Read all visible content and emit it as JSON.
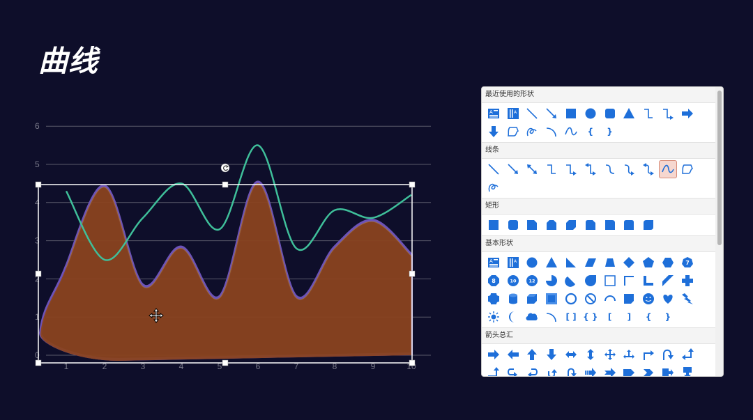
{
  "slide": {
    "title": "曲线"
  },
  "chart_data": {
    "type": "area",
    "x": [
      1,
      2,
      3,
      4,
      5,
      6,
      7,
      8,
      9,
      10
    ],
    "yticks": [
      "0",
      "1",
      "2",
      "3",
      "4",
      "5",
      "6"
    ],
    "xticks": [
      "1",
      "2",
      "3",
      "4",
      "5",
      "6",
      "7",
      "8",
      "9",
      "10"
    ],
    "ylim": [
      0,
      6
    ],
    "grid": true,
    "series": [
      {
        "type": "line",
        "values": [
          4.3,
          2.5,
          3.6,
          4.5,
          3.3,
          5.5,
          2.8,
          3.8,
          3.6,
          4.2
        ],
        "color": "#3fbf9a"
      },
      {
        "type": "area",
        "values": [
          2.3,
          4.4,
          1.8,
          2.8,
          1.5,
          4.5,
          1.5,
          2.8,
          3.5,
          2.6
        ],
        "color": "#8a431f"
      }
    ]
  },
  "shape_panel": {
    "sections": [
      {
        "title": "最近使用的形状",
        "items": [
          "text-box-icon",
          "vertical-text-box-icon",
          "line-icon",
          "arrow-line-icon",
          "rectangle-icon",
          "ellipse-icon",
          "rounded-rectangle-icon",
          "triangle-icon",
          "elbow-connector-icon",
          "elbow-arrow-connector-icon",
          "right-arrow-icon",
          "down-arrow-icon",
          "freeform-icon",
          "scribble-icon",
          "arc-icon",
          "curve-icon",
          "left-brace-icon",
          "right-brace-icon"
        ]
      },
      {
        "title": "线条",
        "items": [
          "line-icon",
          "arrow-line-icon",
          "double-arrow-line-icon",
          "elbow-connector-icon",
          "elbow-arrow-connector-icon",
          "elbow-double-arrow-connector-icon",
          "curved-connector-icon",
          "curved-arrow-connector-icon",
          "curved-double-arrow-connector-icon",
          "curve-icon",
          "freeform-icon",
          "scribble-icon"
        ],
        "selected": 9
      },
      {
        "title": "矩形",
        "items": [
          "rectangle-icon",
          "rounded-rectangle-icon",
          "snip-single-corner-rectangle-icon",
          "snip-same-side-rectangle-icon",
          "snip-diagonal-rectangle-icon",
          "snip-round-rectangle-icon",
          "round-single-corner-rectangle-icon",
          "round-same-side-rectangle-icon",
          "round-diagonal-rectangle-icon"
        ]
      },
      {
        "title": "基本形状",
        "items": [
          "text-box-icon",
          "vertical-text-box-icon",
          "ellipse-icon",
          "triangle-icon",
          "right-triangle-icon",
          "parallelogram-icon",
          "trapezoid-icon",
          "diamond-icon",
          "pentagon-icon",
          "hexagon-icon",
          "heptagon-icon",
          "octagon-icon",
          "decagon-icon",
          "dodecagon-icon",
          "pie-icon",
          "chord-icon",
          "teardrop-icon",
          "frame-icon",
          "half-frame-icon",
          "l-shape-icon",
          "diagonal-stripe-icon",
          "cross-icon",
          "plaque-icon",
          "can-icon",
          "cube-icon",
          "bevel-icon",
          "donut-icon",
          "no-symbol-icon",
          "block-arc-icon",
          "folded-corner-icon",
          "smiley-face-icon",
          "heart-icon",
          "lightning-bolt-icon",
          "sun-icon",
          "moon-icon",
          "cloud-icon",
          "arc-icon",
          "double-bracket-icon",
          "double-brace-icon",
          "left-bracket-icon",
          "right-bracket-icon",
          "left-brace-icon",
          "right-brace-icon"
        ]
      },
      {
        "title": "箭头总汇",
        "items": [
          "right-arrow-icon",
          "left-arrow-icon",
          "up-arrow-icon",
          "down-arrow-icon",
          "left-right-arrow-icon",
          "up-down-arrow-icon",
          "quad-arrow-icon",
          "left-right-up-arrow-icon",
          "bent-arrow-icon",
          "u-turn-arrow-icon",
          "left-up-arrow-icon",
          "bent-up-arrow-icon",
          "curved-right-arrow-icon",
          "curved-left-arrow-icon",
          "curved-up-arrow-icon",
          "curved-down-arrow-icon",
          "striped-right-arrow-icon",
          "notched-right-arrow-icon",
          "pentagon-arrow-icon",
          "chevron-arrow-icon",
          "right-arrow-callout-icon",
          "down-arrow-callout-icon",
          "left-arrow-callout-icon",
          "up-arrow-callout-icon",
          "left-right-arrow-callout-icon",
          "quad-arrow-callout-icon",
          "circular-arrow-icon"
        ]
      }
    ],
    "labels": {
      "heptagon": "7",
      "octagon": "8",
      "decagon": "10",
      "dodecagon": "12"
    }
  }
}
